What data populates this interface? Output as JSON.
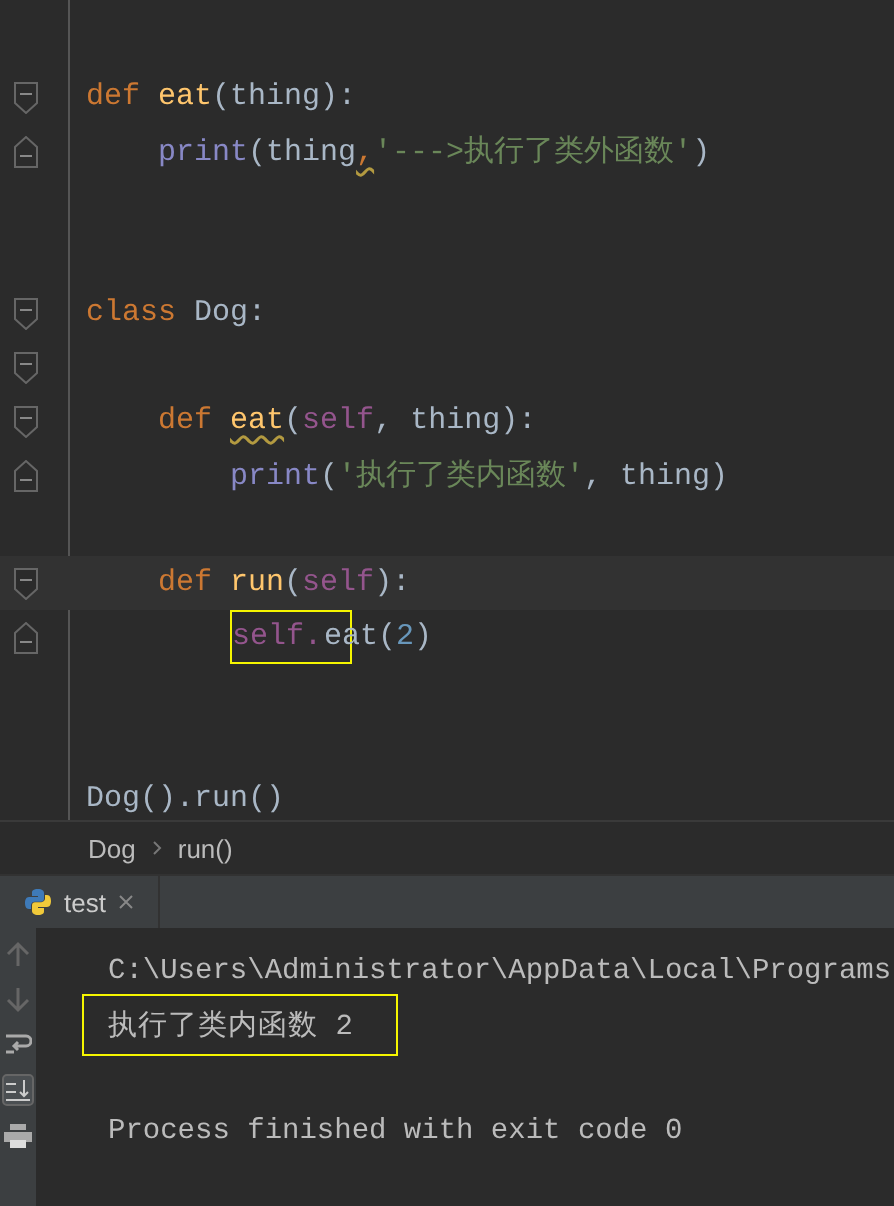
{
  "editor": {
    "lines": [
      {
        "kind": "plain"
      },
      {
        "kind": "fold-start",
        "tokens": [
          {
            "kind": "keyword",
            "text": "def "
          },
          {
            "kind": "func",
            "text": "eat"
          },
          {
            "kind": "plain",
            "text": "(thing):"
          }
        ],
        "children": [
          {
            "kind": "fold-end",
            "tokens": [
              {
                "kind": "builtin",
                "text": "print"
              },
              {
                "kind": "plain",
                "text": "(thing"
              },
              {
                "kind": "warn",
                "text": ","
              },
              {
                "kind": "string",
                "text": "'--->执行了类外函数'"
              },
              {
                "kind": "plain",
                "text": ")"
              }
            ]
          }
        ]
      },
      {
        "kind": "plain"
      },
      {
        "kind": "plain"
      },
      {
        "kind": "fold-start",
        "tokens": [
          {
            "kind": "keyword",
            "text": "class "
          },
          {
            "kind": "plain",
            "text": "Dog:"
          }
        ],
        "children": [
          {
            "kind": "fold-start"
          },
          {
            "kind": "fold-start",
            "tokens": [
              {
                "kind": "keyword",
                "text": "def "
              },
              {
                "kind": "funcwarn",
                "text": "eat"
              },
              {
                "kind": "plain",
                "text": "("
              },
              {
                "kind": "self",
                "text": "self"
              },
              {
                "kind": "plain",
                "text": ", thing):"
              }
            ],
            "children": [
              {
                "kind": "fold-end",
                "tokens": [
                  {
                    "kind": "builtin",
                    "text": "print"
                  },
                  {
                    "kind": "plain",
                    "text": "("
                  },
                  {
                    "kind": "string",
                    "text": "'执行了类内函数'"
                  },
                  {
                    "kind": "plain",
                    "text": ", thing)"
                  }
                ]
              }
            ]
          },
          {
            "kind": "plain"
          },
          {
            "kind": "fold-start",
            "current": true,
            "tokens": [
              {
                "kind": "keyword",
                "text": "def "
              },
              {
                "kind": "func",
                "text": "run"
              },
              {
                "kind": "plain",
                "text": "("
              },
              {
                "kind": "self",
                "text": "self"
              },
              {
                "kind": "plain",
                "text": "):"
              }
            ],
            "children": [
              {
                "kind": "fold-end",
                "tokens": [
                  {
                    "kind": "self",
                    "text": "self.",
                    "boxed": true
                  },
                  {
                    "kind": "plain",
                    "text": "eat("
                  },
                  {
                    "kind": "number",
                    "text": "2"
                  },
                  {
                    "kind": "plain",
                    "text": ")"
                  }
                ]
              }
            ]
          }
        ]
      },
      {
        "kind": "plain"
      },
      {
        "kind": "plain"
      },
      {
        "kind": "plain",
        "tokens": [
          {
            "kind": "plain",
            "text": "Dog().run()"
          }
        ]
      }
    ]
  },
  "breadcrumbs": [
    "Dog",
    "run()"
  ],
  "run_tab": {
    "label": "test"
  },
  "console": {
    "lines": [
      {
        "text": "C:\\Users\\Administrator\\AppData\\Local\\Programs",
        "boxed": false
      },
      {
        "text": "执行了类内函数 2",
        "boxed": true
      },
      {
        "text": "Process finished with exit code 0",
        "boxed": false
      }
    ]
  }
}
